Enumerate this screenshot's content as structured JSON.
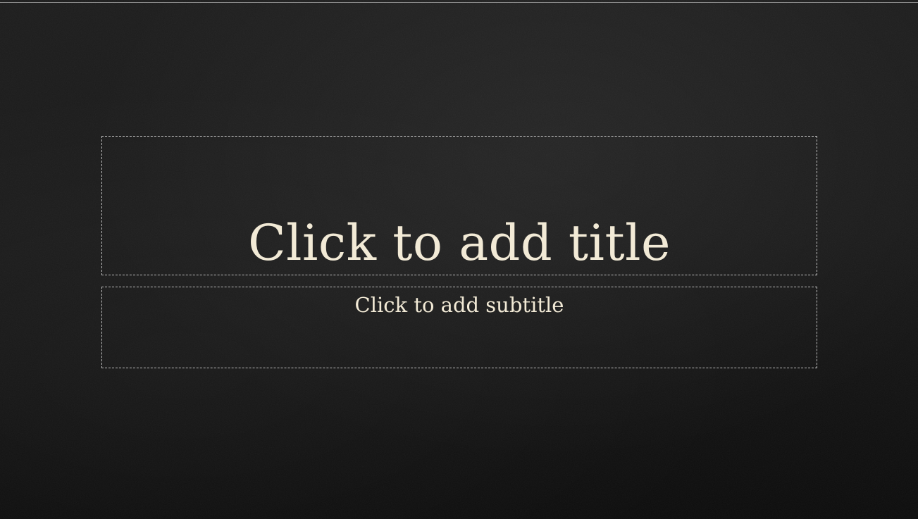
{
  "slide": {
    "title_placeholder": "Click to add title",
    "subtitle_placeholder": "Click to add subtitle"
  },
  "colors": {
    "background": "#181818",
    "text": "#f2ead6",
    "placeholder_border": "#bdbdbd"
  }
}
